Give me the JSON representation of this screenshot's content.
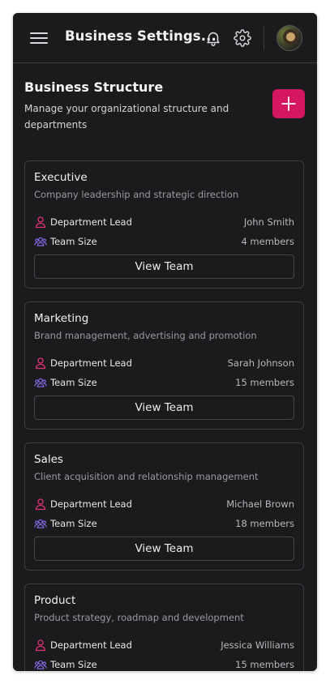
{
  "header": {
    "title": "Business Settings...",
    "icons": [
      "menu-icon",
      "bell-icon",
      "gear-icon",
      "avatar"
    ]
  },
  "page": {
    "heading": "Business Structure",
    "subtitle": "Manage your organizational structure and departments",
    "add_icon": "plus-icon"
  },
  "colors": {
    "accent": "#d4155f",
    "lead_icon": "#e0307a",
    "team_icon": "#8a6cf0",
    "background": "#1b1b1d"
  },
  "departments": [
    {
      "name": "Executive",
      "description": "Company leadership and strategic direction",
      "lead_label": "Department Lead",
      "lead": "John Smith",
      "size_label": "Team Size",
      "size": "4 members",
      "button": "View Team"
    },
    {
      "name": "Marketing",
      "description": "Brand management, advertising and promotion",
      "lead_label": "Department Lead",
      "lead": "Sarah Johnson",
      "size_label": "Team Size",
      "size": "15 members",
      "button": "View Team"
    },
    {
      "name": "Sales",
      "description": "Client acquisition and relationship management",
      "lead_label": "Department Lead",
      "lead": "Michael Brown",
      "size_label": "Team Size",
      "size": "18 members",
      "button": "View Team"
    },
    {
      "name": "Product",
      "description": "Product strategy, roadmap and development",
      "lead_label": "Department Lead",
      "lead": "Jessica Williams",
      "size_label": "Team Size",
      "size": "15 members",
      "button": "View Team"
    }
  ]
}
